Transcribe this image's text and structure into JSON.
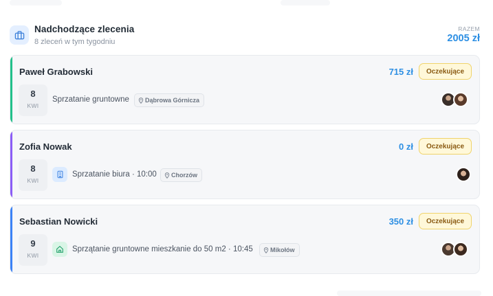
{
  "header": {
    "title": "Nadchodzące zlecenia",
    "subtitle": "8 zleceń w tym tygodniu",
    "total_label": "RAZEM",
    "total_value": "2005 zł",
    "icon": "briefcase-icon"
  },
  "orders": [
    {
      "client": "Paweł Grabowski",
      "amount": "715 zł",
      "status": "Oczekujące",
      "day": "8",
      "month": "KWI",
      "service": "Sprzatanie gruntowne",
      "location": "Dąbrowa Górnicza",
      "accent": "#22c08a",
      "service_icon": null,
      "assignees": 2
    },
    {
      "client": "Zofia Nowak",
      "amount": "0 zł",
      "status": "Oczekujące",
      "day": "8",
      "month": "KWI",
      "service": "Sprzatanie biura · 10:00",
      "location": "Chorzów",
      "accent": "#8b5cf6",
      "service_icon": "office-building-icon",
      "assignees": 1
    },
    {
      "client": "Sebastian Nowicki",
      "amount": "350 zł",
      "status": "Oczekujące",
      "day": "9",
      "month": "KWI",
      "service": "Sprzątanie gruntowne mieszkanie do 50 m2 · 10:45",
      "location": "Mikołów",
      "accent": "#3b82f6",
      "service_icon": "home-icon",
      "assignees": 2
    }
  ],
  "colors": {
    "amount": "#2d8fe3",
    "badge_bg": "#fff8d9",
    "badge_border": "#f0d36a",
    "badge_text": "#8a5a12"
  }
}
